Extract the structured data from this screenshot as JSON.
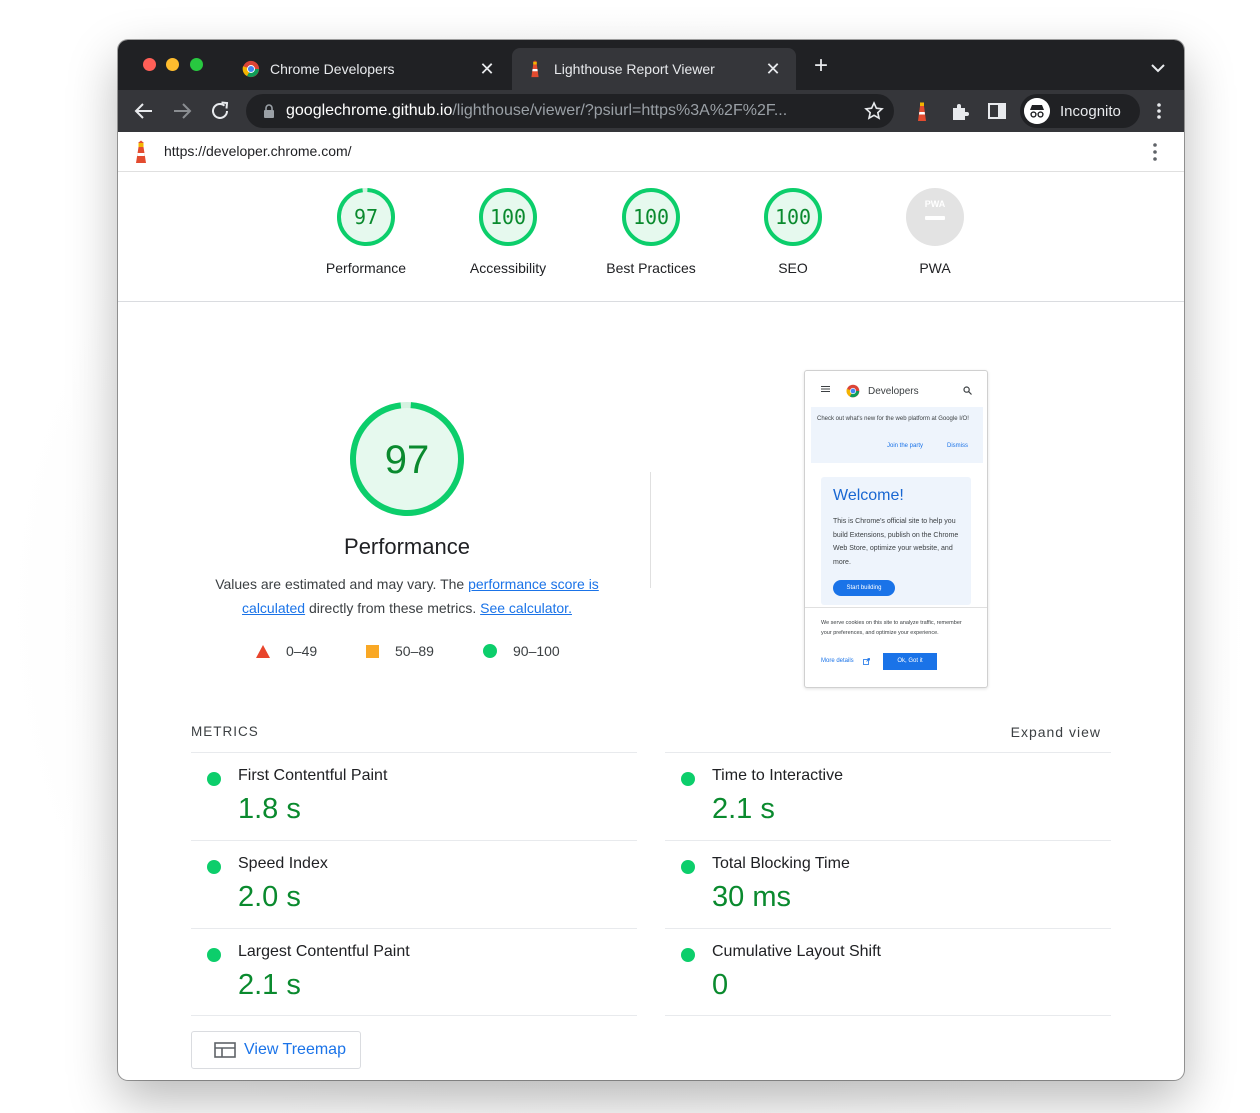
{
  "browser": {
    "tabs": [
      {
        "title": "Chrome Developers",
        "favicon": "chrome-icon",
        "active": false
      },
      {
        "title": "Lighthouse Report Viewer",
        "favicon": "lighthouse-icon",
        "active": true
      }
    ],
    "new_tab_label": "+",
    "omnibox": {
      "host": "googlechrome.github.io",
      "path": "/lighthouse/viewer/?psiurl=https%3A%2F%2F..."
    },
    "incognito_label": "Incognito"
  },
  "report": {
    "url": "https://developer.chrome.com/",
    "categories": [
      {
        "score": "97",
        "label": "Performance"
      },
      {
        "score": "100",
        "label": "Accessibility"
      },
      {
        "score": "100",
        "label": "Best Practices"
      },
      {
        "score": "100",
        "label": "SEO"
      },
      {
        "score": "PWA",
        "label": "PWA"
      }
    ],
    "performance": {
      "score": "97",
      "title": "Performance",
      "desc_before": "Values are estimated and may vary. The ",
      "link1": "performance score is calculated",
      "desc_middle": " directly from these metrics. ",
      "link2": "See calculator."
    },
    "legend": [
      {
        "range": "0–49",
        "shape": "triangle",
        "color": "#e8452c"
      },
      {
        "range": "50–89",
        "shape": "square",
        "color": "#f9a825"
      },
      {
        "range": "90–100",
        "shape": "circle",
        "color": "#0cce6b"
      }
    ],
    "screenshot": {
      "brand": "Developers",
      "banner_text": "Check out what's new for the web platform at Google I/O!",
      "banner_join": "Join the party",
      "banner_dismiss": "Dismiss",
      "welcome": "Welcome!",
      "hero_text": "This is Chrome's official site to help you build Extensions, publish on the Chrome Web Store, optimize your website, and more.",
      "start_button": "Start building",
      "cookie_text": "We serve cookies on this site to analyze traffic, remember your preferences, and optimize your experience.",
      "more_details": "More details",
      "ok_button": "Ok, Got it"
    },
    "metrics_title": "METRICS",
    "expand_view": "Expand view",
    "metrics": [
      {
        "name": "First Contentful Paint",
        "value": "1.8 s"
      },
      {
        "name": "Time to Interactive",
        "value": "2.1 s"
      },
      {
        "name": "Speed Index",
        "value": "2.0 s"
      },
      {
        "name": "Total Blocking Time",
        "value": "30 ms"
      },
      {
        "name": "Largest Contentful Paint",
        "value": "2.1 s"
      },
      {
        "name": "Cumulative Layout Shift",
        "value": "0"
      }
    ],
    "treemap_label": "View Treemap"
  },
  "colors": {
    "pass": "#0cce6b",
    "pass_text": "#0a8a2e",
    "link": "#1a73e8"
  }
}
